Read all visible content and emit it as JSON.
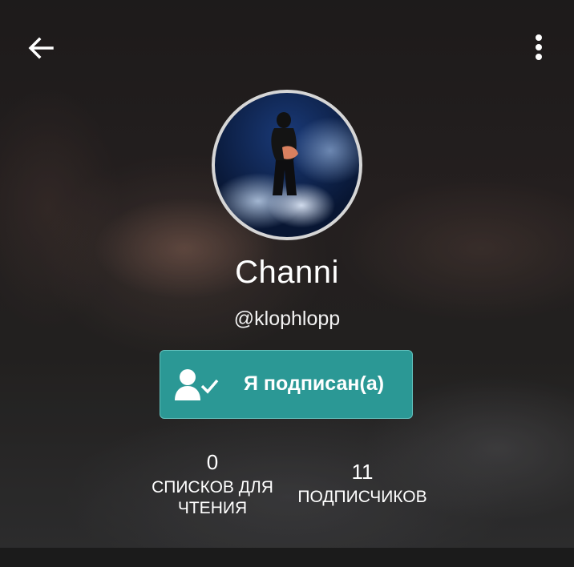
{
  "profile": {
    "name": "Channi",
    "username": "@klophlopp"
  },
  "follow_button": {
    "label": "Я подписан(а)",
    "icon": "user-check-icon",
    "color": "#2b9895"
  },
  "stats": [
    {
      "value": "0",
      "label": "СПИСКОВ ДЛЯ ЧТЕНИЯ"
    },
    {
      "value": "11",
      "label": "ПОДПИСЧИКОВ"
    }
  ],
  "toolbar": {
    "back_icon": "arrow-left-icon",
    "menu_icon": "more-vertical-icon"
  }
}
